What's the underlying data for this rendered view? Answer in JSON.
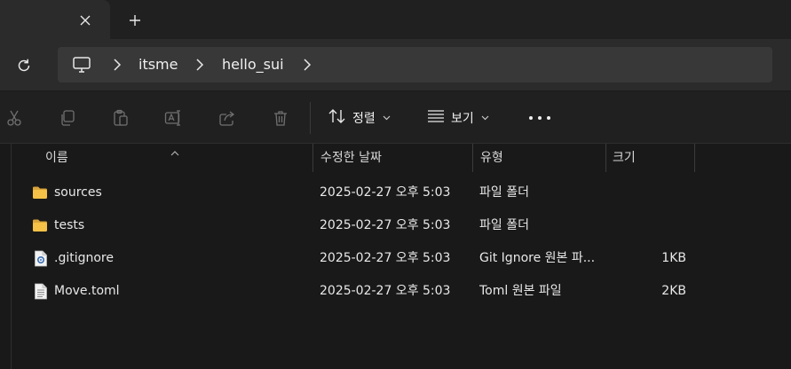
{
  "tabstrip": {
    "close_icon": "close-icon",
    "new_tab_icon": "plus-icon"
  },
  "address": {
    "refresh_icon": "refresh-icon",
    "root_icon": "computer-icon",
    "crumbs": [
      "itsme",
      "hello_sui"
    ]
  },
  "toolbar": {
    "icons": [
      "cut-icon",
      "copy-icon",
      "paste-icon",
      "rename-icon",
      "share-icon",
      "delete-icon"
    ],
    "sort_label": "정렬",
    "view_label": "보기",
    "more_icon": "more-icon"
  },
  "columns": {
    "name": "이름",
    "date": "수정한 날짜",
    "type": "유형",
    "size": "크기"
  },
  "files": [
    {
      "icon": "folder-icon",
      "name": "sources",
      "date": "2025-02-27 오후 5:03",
      "type": "파일 폴더",
      "size": ""
    },
    {
      "icon": "folder-icon",
      "name": "tests",
      "date": "2025-02-27 오후 5:03",
      "type": "파일 폴더",
      "size": ""
    },
    {
      "icon": "config-file-icon",
      "name": ".gitignore",
      "date": "2025-02-27 오후 5:03",
      "type": "Git Ignore 원본 파...",
      "size": "1KB"
    },
    {
      "icon": "text-file-icon",
      "name": "Move.toml",
      "date": "2025-02-27 오후 5:03",
      "type": "Toml 원본 파일",
      "size": "2KB"
    }
  ],
  "colors": {
    "folder": "#f5c146",
    "background": "#191919",
    "toolbar": "#202020"
  }
}
